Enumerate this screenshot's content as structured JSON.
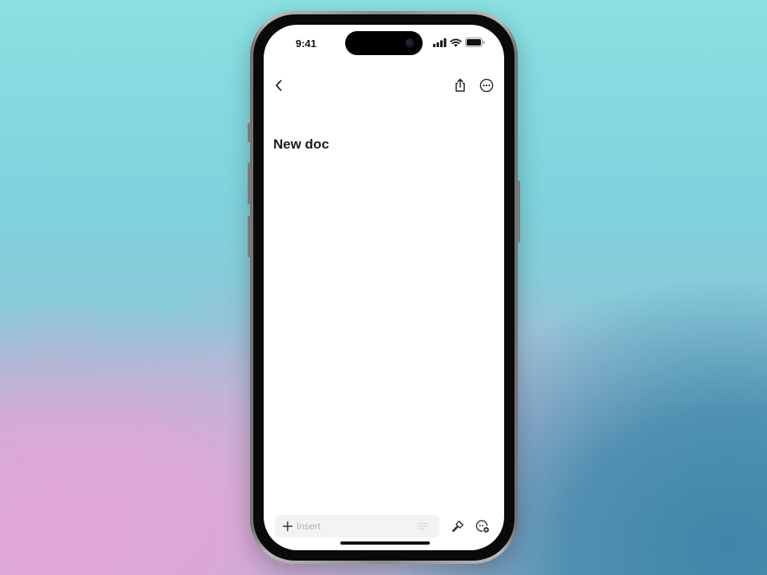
{
  "status_bar": {
    "time": "9:41",
    "icons": [
      "cellular-signal-icon",
      "wifi-icon",
      "battery-icon"
    ]
  },
  "navbar": {
    "back_icon": "chevron-left-icon",
    "share_icon": "share-icon",
    "more_icon": "more-icon"
  },
  "document": {
    "title": "New doc"
  },
  "toolbar": {
    "insert_placeholder": "Insert",
    "insert_icon": "plus-icon",
    "format_icon": "text-lines-icon",
    "style_icon": "paintbrush-icon",
    "ai_icon": "assistant-icon"
  },
  "colors": {
    "screen_background": "#ffffff",
    "title_text": "#1c1c1c",
    "placeholder_text": "#b2b2b2",
    "insert_field_background": "#f3f3f3"
  }
}
